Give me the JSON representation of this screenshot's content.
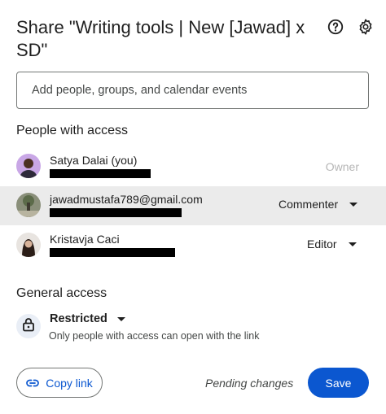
{
  "dialog": {
    "title": "Share \"Writing tools | New [Jawad] x SD\"",
    "help_icon": "help-circle-icon",
    "settings_icon": "gear-icon"
  },
  "add_people": {
    "placeholder": "Add people, groups, and calendar events"
  },
  "people_section": {
    "title": "People with access",
    "people": [
      {
        "name": "Satya Dalai (you)",
        "email_redacted": true,
        "role": "Owner",
        "role_editable": false
      },
      {
        "name": "jawadmustafa789@gmail.com",
        "email_redacted": true,
        "role": "Commenter",
        "role_editable": true,
        "highlighted": true
      },
      {
        "name": "Kristavja Caci",
        "email_redacted": true,
        "role": "Editor",
        "role_editable": true
      }
    ]
  },
  "general_access": {
    "title": "General access",
    "icon": "lock-icon",
    "level": "Restricted",
    "description": "Only people with access can open with the link"
  },
  "footer": {
    "copy_link_label": "Copy link",
    "copy_link_icon": "link-icon",
    "pending_text": "Pending changes",
    "save_label": "Save"
  },
  "colors": {
    "accent": "#0b57d0",
    "highlight_row": "#ebebeb",
    "owner_text": "#b6b6b6"
  }
}
